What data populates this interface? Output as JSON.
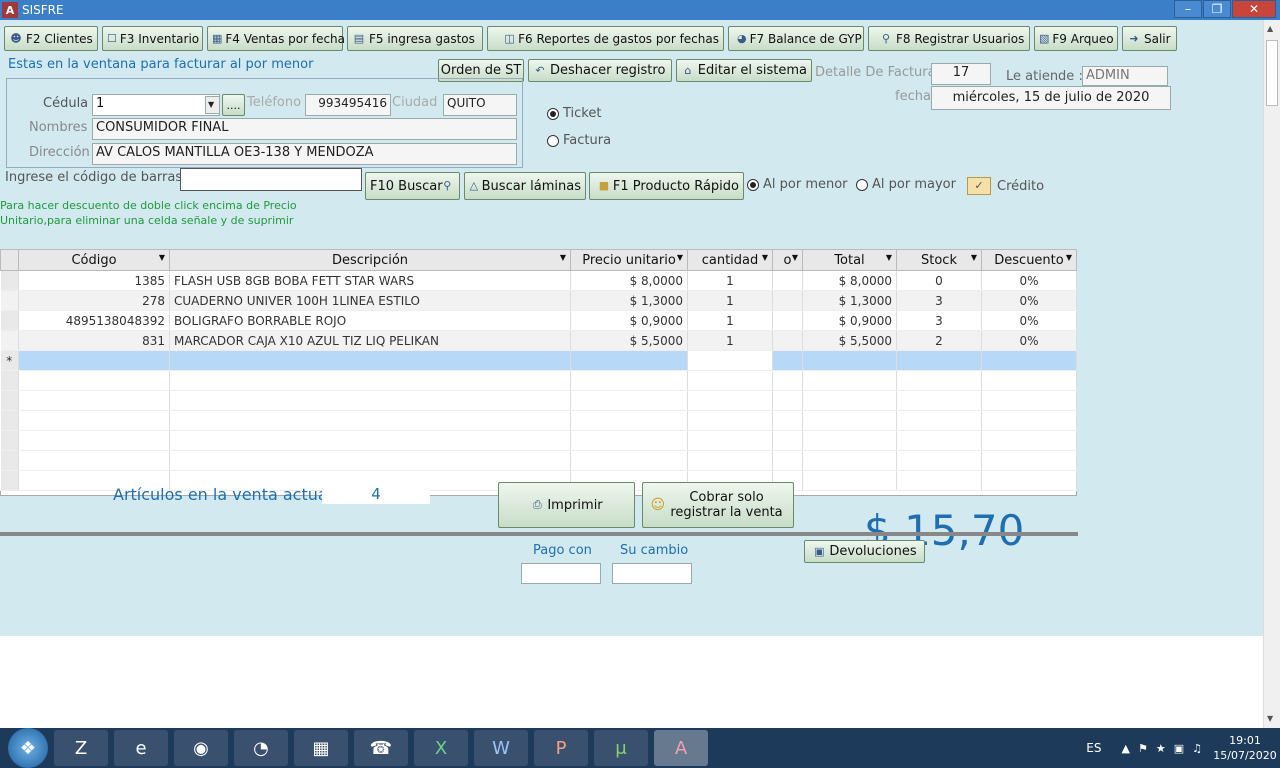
{
  "window": {
    "title": "SISFRE",
    "app_icon": "A"
  },
  "toolbar": [
    {
      "label": "F2 Clientes",
      "icon": "people-icon"
    },
    {
      "label": "F3 Inventario",
      "icon": "clipboard-icon"
    },
    {
      "label": "F4 Ventas por fecha",
      "icon": "calendar-icon"
    },
    {
      "label": "F5 ingresa  gastos",
      "icon": "chart-icon"
    },
    {
      "label": "F6 Reportes de gastos por fechas",
      "icon": "report-icon"
    },
    {
      "label": "F7 Balance de GYP",
      "icon": "pie-icon"
    },
    {
      "label": "F8 Registrar Usuarios",
      "icon": "key-icon"
    },
    {
      "label": "F9 Arqueo",
      "icon": "money-icon"
    },
    {
      "label": "Salir",
      "icon": "exit-icon"
    }
  ],
  "info_text": "Estas en la ventana para facturar al por menor",
  "actions": {
    "orden": "Orden de ST",
    "deshacer": "Deshacer registro",
    "editar": "Editar el sistema"
  },
  "factura": {
    "detalle_label": "Detalle De Factura",
    "detalle_value": "17",
    "atiende_label": "Le atiende :",
    "atiende_value": "ADMIN",
    "fecha_label": "fecha",
    "fecha_value": "miércoles, 15 de julio de 2020"
  },
  "cliente": {
    "cedula_label": "Cédula",
    "cedula_value": "1",
    "more_button": "....",
    "telefono_label": "Teléfono",
    "telefono_value": "993495416",
    "ciudad_label": "Ciudad",
    "ciudad_value": "QUITO",
    "nombres_label": "Nombres",
    "nombres_value": "CONSUMIDOR FINAL",
    "direccion_label": "Dirección",
    "direccion_value": "AV CALOS MANTILLA OE3-138 Y MENDOZA"
  },
  "doc_type": {
    "ticket": "Ticket",
    "factura": "Factura"
  },
  "barcode": {
    "label": "Ingrese el código de barras",
    "value": ""
  },
  "search": {
    "f10": "F10 Buscar",
    "laminas": "Buscar láminas",
    "f1": "F1 Producto Rápido"
  },
  "price_mode": {
    "menor": "Al por menor",
    "mayor": "Al por mayor",
    "credito": "Crédito"
  },
  "hint": [
    "Para hacer descuento de doble click encima de Precio",
    "Unitario,para eliminar una celda señale y de suprimir"
  ],
  "grid": {
    "columns": [
      "Código",
      "Descripción",
      "Precio unitario",
      "cantidad",
      "o",
      "Total",
      "Stock",
      "Descuento"
    ],
    "rows": [
      [
        "1385",
        "FLASH USB 8GB BOBA FETT STAR WARS",
        "$ 8,0000",
        "1",
        "",
        "$ 8,0000",
        "0",
        "0%"
      ],
      [
        "278",
        "CUADERNO UNIVER 100H 1LINEA ESTILO",
        "$ 1,3000",
        "1",
        "",
        "$ 1,3000",
        "3",
        "0%"
      ],
      [
        "4895138048392",
        "BOLIGRAFO BORRABLE ROJO",
        "$ 0,9000",
        "1",
        "",
        "$ 0,9000",
        "3",
        "0%"
      ],
      [
        "831",
        "MARCADOR CAJA X10 AZUL TIZ LIQ PELIKAN",
        "$ 5,5000",
        "1",
        "",
        "$ 5,5000",
        "2",
        "0%"
      ]
    ],
    "new_row_marker": "*"
  },
  "summary": {
    "articulos_label": "Artículos en la venta actual",
    "articulos_value": "4",
    "imprimir": "Imprimir",
    "cobrar": "Cobrar solo registrar la venta",
    "total": "$ 15,70",
    "devoluciones": "Devoluciones",
    "pago_label": "Pago con",
    "cambio_label": "Su cambio"
  },
  "tray": {
    "lang": "ES",
    "time": "19:01",
    "date": "15/07/2020"
  }
}
